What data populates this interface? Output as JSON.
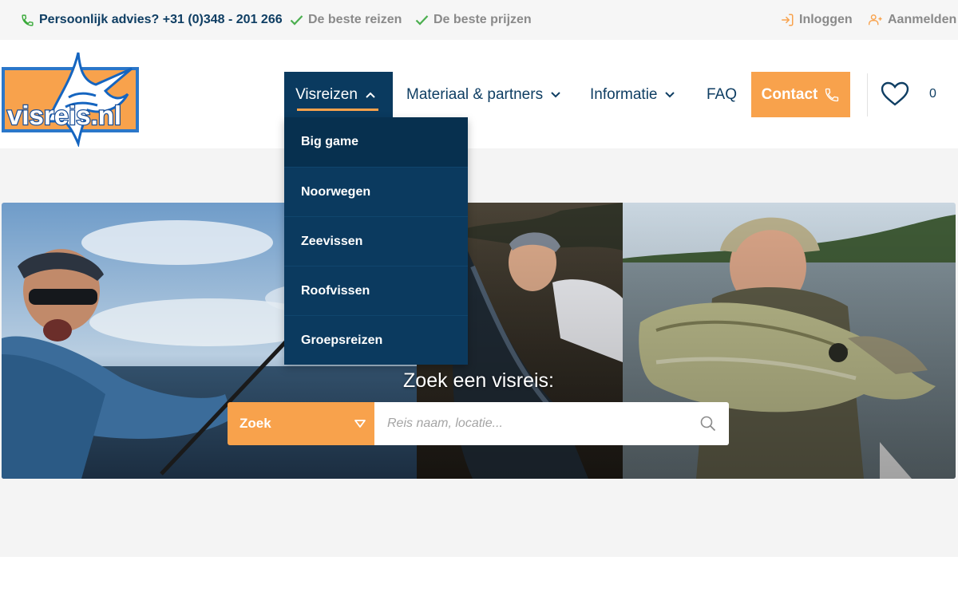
{
  "topbar": {
    "phone_text": "Persoonlijk advies? +31 (0)348 - 201 266",
    "best_trips": "De beste reizen",
    "best_prices": "De beste prijzen",
    "login": "Inloggen",
    "register": "Aanmelden"
  },
  "logo": {
    "text": "visreis.nl"
  },
  "nav": {
    "visreizen": "Visreizen",
    "materiaal": "Materiaal & partners",
    "informatie": "Informatie",
    "faq": "FAQ",
    "contact": "Contact",
    "favorites_count": "0"
  },
  "dropdown": {
    "items": [
      "Big game",
      "Noorwegen",
      "Zeevissen",
      "Roofvissen",
      "Groepsreizen"
    ]
  },
  "hero": {
    "title": "Zoek een visreis:"
  },
  "search": {
    "select_value": "Zoek",
    "placeholder": "Reis naam, locatie..."
  },
  "colors": {
    "accent": "#f8a24c",
    "navy": "#0f3e63",
    "dropdown_bg": "#0b3a5f",
    "check_green": "#4caf50"
  },
  "icons": {
    "phone": "phone-icon",
    "check": "check-icon",
    "login": "login-icon",
    "register": "add-user-icon",
    "chevron": "chevron-down-icon",
    "heart": "heart-icon",
    "search": "search-icon"
  }
}
